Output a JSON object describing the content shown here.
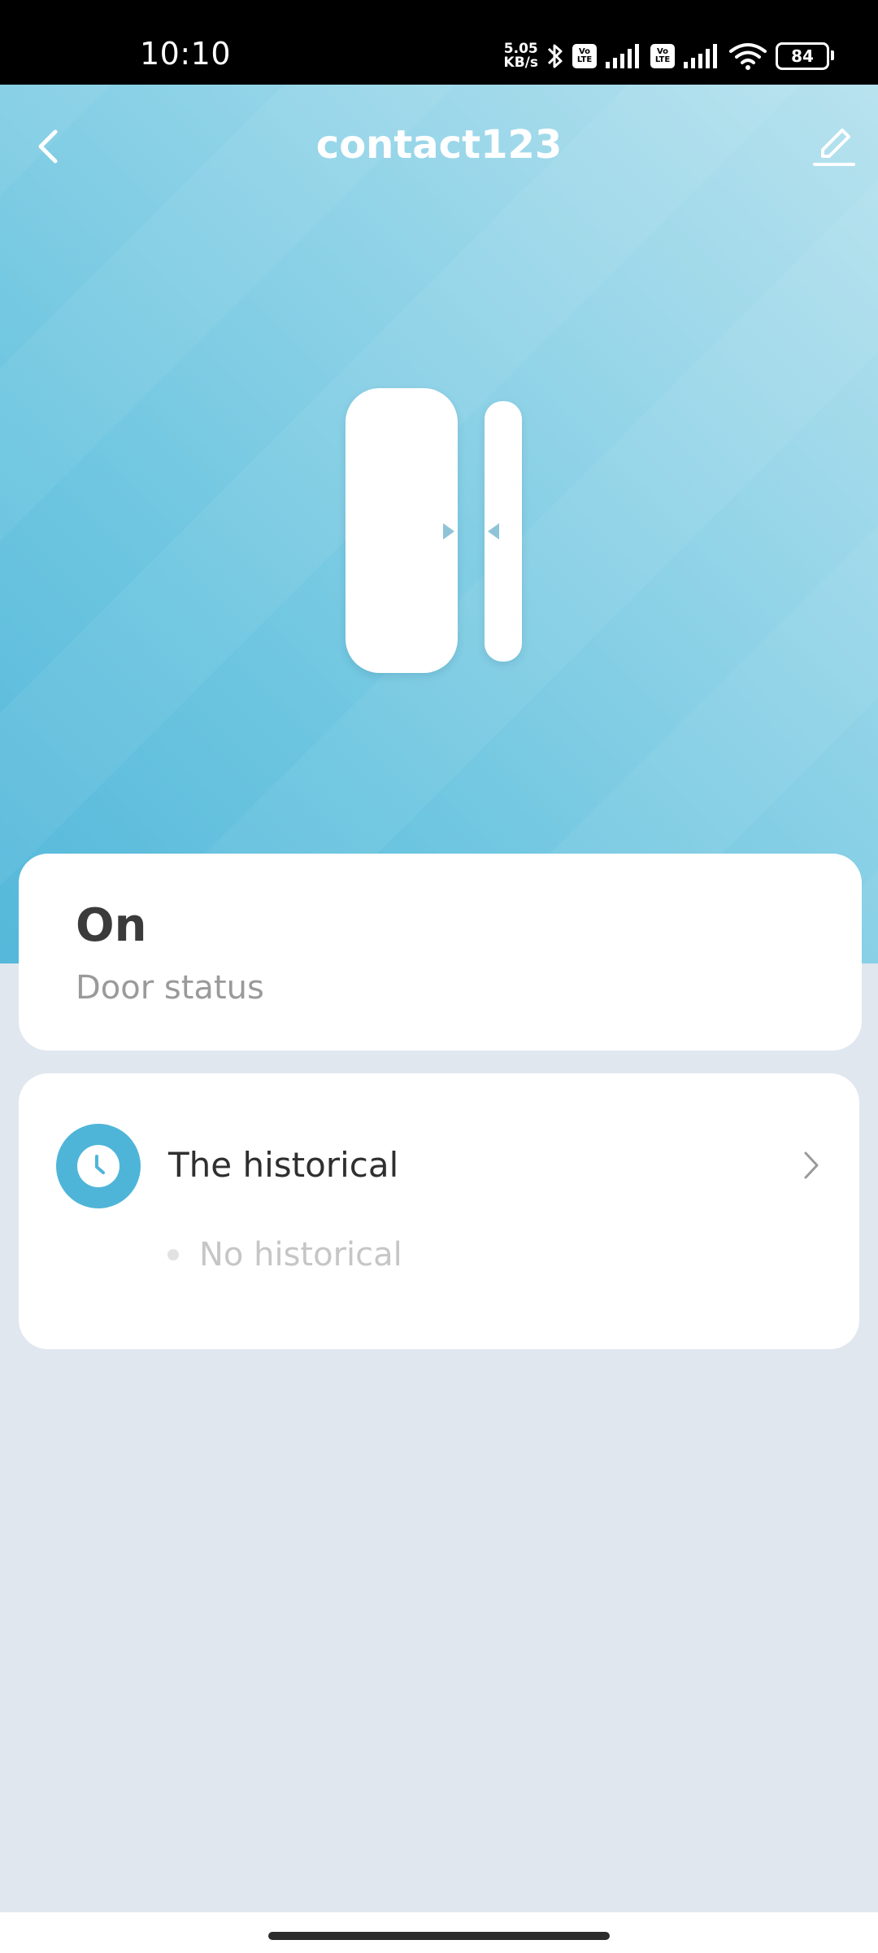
{
  "status_bar": {
    "time": "10:10",
    "net_speed_value": "5.05",
    "net_speed_unit": "KB/s",
    "volte_line1": "Vo",
    "volte_line2": "LTE",
    "battery": "84",
    "icons": [
      "bluetooth-icon",
      "volte-icon",
      "signal-icon",
      "volte-icon",
      "signal-icon",
      "wifi-icon",
      "battery-icon"
    ]
  },
  "header": {
    "title": "contact123",
    "back_icon": "chevron-left-icon",
    "edit_icon": "pencil-icon"
  },
  "status_card": {
    "value": "On",
    "label": "Door status"
  },
  "history_card": {
    "icon": "clock-icon",
    "title": "The historical",
    "empty_text": "No historical",
    "chevron_icon": "chevron-right-icon"
  },
  "colors": {
    "accent": "#4eb5d8",
    "hero_light": "#b8e2ee",
    "hero_dark": "#55b8da",
    "page_background": "#e0e7ef"
  }
}
